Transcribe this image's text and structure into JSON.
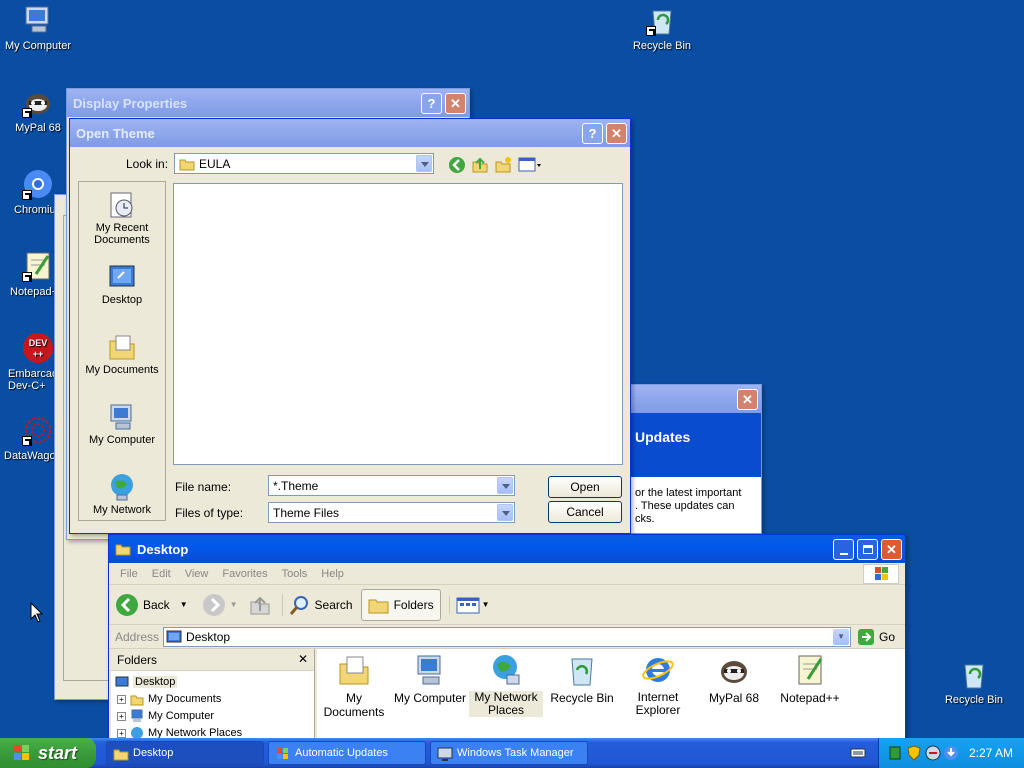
{
  "desktop": {
    "icons": [
      {
        "label": "My Computer"
      },
      {
        "label": "MyPal 68"
      },
      {
        "label": "Chromiu"
      },
      {
        "label": "Notepad+"
      },
      {
        "label": "Embarcad\nDev-C+"
      },
      {
        "label": "DataWago"
      },
      {
        "label": "Recycle Bin"
      },
      {
        "label": "Recycle Bin"
      }
    ]
  },
  "display_properties": {
    "title": "Display Properties",
    "help": "?",
    "close": "✕"
  },
  "auto_updates_window": {
    "heading": "Updates",
    "body_line1": "or the latest important",
    "body_line2": ". These updates can",
    "body_line3": "cks.",
    "close": "✕"
  },
  "open_theme": {
    "title": "Open Theme",
    "help": "?",
    "close": "✕",
    "look_in_label": "Look in:",
    "look_in_value": "EULA",
    "places": [
      {
        "label": "My Recent\nDocuments"
      },
      {
        "label": "Desktop"
      },
      {
        "label": "My Documents"
      },
      {
        "label": "My Computer"
      },
      {
        "label": "My Network"
      }
    ],
    "file_name_label": "File name:",
    "file_name_value": "*.Theme",
    "files_of_type_label": "Files of type:",
    "files_of_type_value": "Theme Files",
    "open_button": "Open",
    "cancel_button": "Cancel"
  },
  "explorer": {
    "title": "Desktop",
    "menu": [
      "File",
      "Edit",
      "View",
      "Favorites",
      "Tools",
      "Help"
    ],
    "toolbar": {
      "back": "Back",
      "search": "Search",
      "folders": "Folders"
    },
    "address_label": "Address",
    "address_value": "Desktop",
    "go": "Go",
    "folders_pane_title": "Folders",
    "folders_close": "✕",
    "tree": [
      {
        "label": "Desktop",
        "expander": ""
      },
      {
        "label": "My Documents",
        "expander": "+"
      },
      {
        "label": "My Computer",
        "expander": "+"
      },
      {
        "label": "My Network Places",
        "expander": "+"
      }
    ],
    "items": [
      {
        "label": "My Documents"
      },
      {
        "label": "My Computer"
      },
      {
        "label": "My Network\nPlaces"
      },
      {
        "label": "Recycle Bin"
      },
      {
        "label": "Internet\nExplorer"
      },
      {
        "label": "MyPal 68"
      },
      {
        "label": "Notepad++"
      }
    ]
  },
  "taskbar": {
    "start": "start",
    "tasks": [
      {
        "label": "Desktop"
      },
      {
        "label": "Automatic Updates"
      },
      {
        "label": "Windows Task Manager"
      }
    ],
    "clock": "2:27 AM"
  },
  "colors": {
    "desktop": "#0a4ea3",
    "titlebar": "#0058ee",
    "window_face": "#ece9d8",
    "start_green": "#3a9b3a"
  }
}
